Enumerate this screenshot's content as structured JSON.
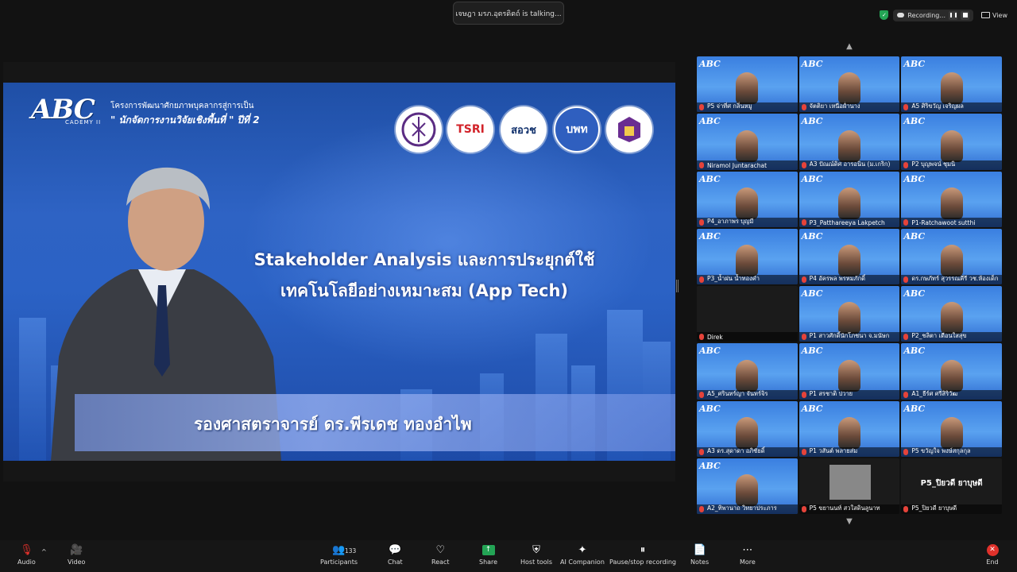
{
  "speaking_banner": "เจษฎา มรภ.อุตรดิตถ์ is talking...",
  "recording": {
    "label": "Recording...",
    "view_label": "View"
  },
  "slide": {
    "logo": "ABC",
    "logo_sub": "CADEMY II",
    "project_line1": "โครงการพัฒนาศักยภาพบุคลากรสู่การเป็น",
    "project_line2": "\" นักจัดการงานวิจัยเชิงพื้นที่ \" ปีที่ 2",
    "partner_logos": [
      "",
      "TSRI",
      "สอวช",
      "บพท",
      ""
    ],
    "title_line1": "Stakeholder Analysis และการประยุกต์ใช้",
    "title_line2": "เทคโนโลยีอย่างเหมาะสม (App Tech)",
    "speaker_name": "รองศาสตราจารย์ ดร.พีรเดช ทองอำไพ"
  },
  "gallery": [
    {
      "name": "P5 จ่าที่ศ กลิ่นหมู"
    },
    {
      "name": "จัตติยา เหนือฝ่ำนาง"
    },
    {
      "name": "A5 ศิริขวัญ เจริญผล"
    },
    {
      "name": "Niramol Juntarachat"
    },
    {
      "name": "A3 ปัณณ์ดิศ อารอนิน (ม.เกริก)"
    },
    {
      "name": "P2 บุญพจน์ ชุมนิ"
    },
    {
      "name": "P4_อาภาพร บุญมี"
    },
    {
      "name": "P3_Pattharееya Lakpetch"
    },
    {
      "name": "P1-Ratchawoot sutthi"
    },
    {
      "name": "P3_น้ำฝน น้ำทองคำ"
    },
    {
      "name": "P4 อัครพล พรหมภักดิ์"
    },
    {
      "name": "ดร.กษภัทร์ สุวรรณคีรี วช.ห้องเด็ก"
    },
    {
      "name": "Direk"
    },
    {
      "name": "P1 สาวศักดิ์นักโภชนา จ.มนัษก"
    },
    {
      "name": "P2_ชลิตา เดือนใสสุข"
    },
    {
      "name": "A5_ศรินทร์ญา จันทร์จิร"
    },
    {
      "name": "P1 สรชาติ ปวาย"
    },
    {
      "name": "A1_ธีร์ศ ศรีสิริวัฒ"
    },
    {
      "name": "A3 ดร.สุดาดา อภิชัยดิ์"
    },
    {
      "name": "P1 วสันต์ พลายส่ม"
    },
    {
      "name": "P5 ขวัญใจ พงษ์สกุลกุล"
    },
    {
      "name": "A2_ทิพานาถ วิทยาประภาร"
    },
    {
      "name": "P5 ขยานนท์ สวใสดินลูนาท"
    },
    {
      "name": "P5_ปิยวดี ยาบุษดี",
      "big": "P5_ปิยวดี ยาบุษดี"
    }
  ],
  "toolbar": {
    "audio": "Audio",
    "video": "Video",
    "participants": "Participants",
    "participants_count": "133",
    "chat": "Chat",
    "react": "React",
    "share": "Share",
    "host_tools": "Host tools",
    "ai_companion": "AI Companion",
    "pause_stop": "Pause/stop recording",
    "notes": "Notes",
    "more": "More",
    "end": "End"
  }
}
